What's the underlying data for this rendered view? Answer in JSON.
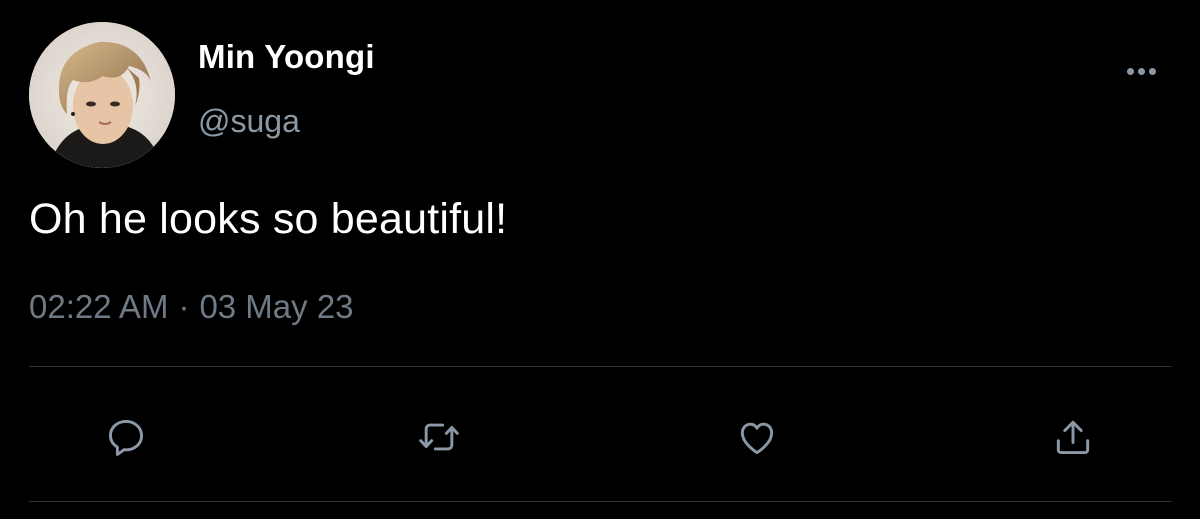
{
  "author": {
    "display_name": "Min Yoongi",
    "handle": "@suga",
    "avatar_icon": "profile-photo"
  },
  "tweet": {
    "text": "Oh he looks so beautiful!",
    "time": "02:22 AM",
    "separator": "·",
    "date": "03 May 23"
  },
  "menu": {
    "more_icon": "more-horizontal-icon"
  },
  "actions": [
    {
      "name": "reply",
      "icon": "speech-bubble-icon"
    },
    {
      "name": "retweet",
      "icon": "retweet-arrows-icon"
    },
    {
      "name": "like",
      "icon": "heart-icon"
    },
    {
      "name": "share",
      "icon": "share-upload-icon"
    }
  ],
  "colors": {
    "background": "#000000",
    "primary_text": "#ffffff",
    "secondary_text": "#8b98a5",
    "divider": "#2f3336"
  }
}
